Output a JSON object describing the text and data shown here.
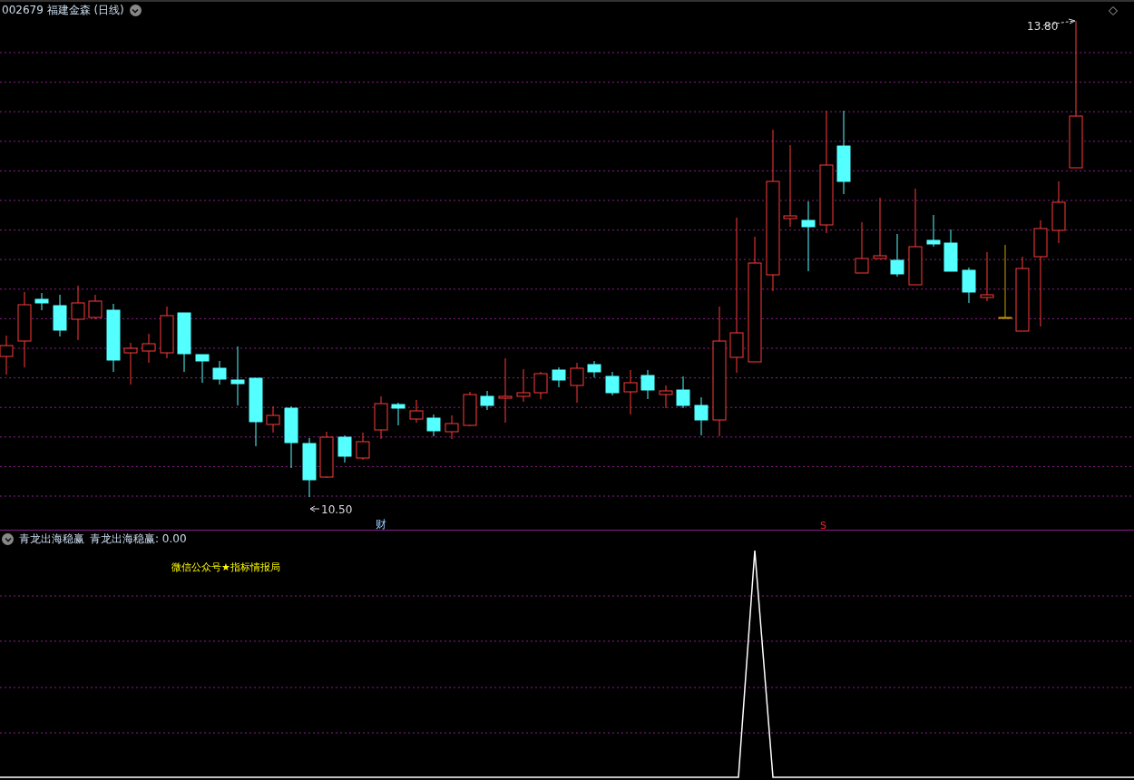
{
  "price_panel": {
    "title": "002679 福建金森 (日线)",
    "high_label": "13.80",
    "low_label": "10.50",
    "markers": [
      {
        "kind": "finance",
        "text": "财"
      },
      {
        "kind": "signal",
        "text": "S"
      }
    ]
  },
  "indicator_panel": {
    "name": "青龙出海稳赢",
    "reading": "青龙出海稳赢: 0.00",
    "note": "微信公众号★指标情报局"
  }
}
